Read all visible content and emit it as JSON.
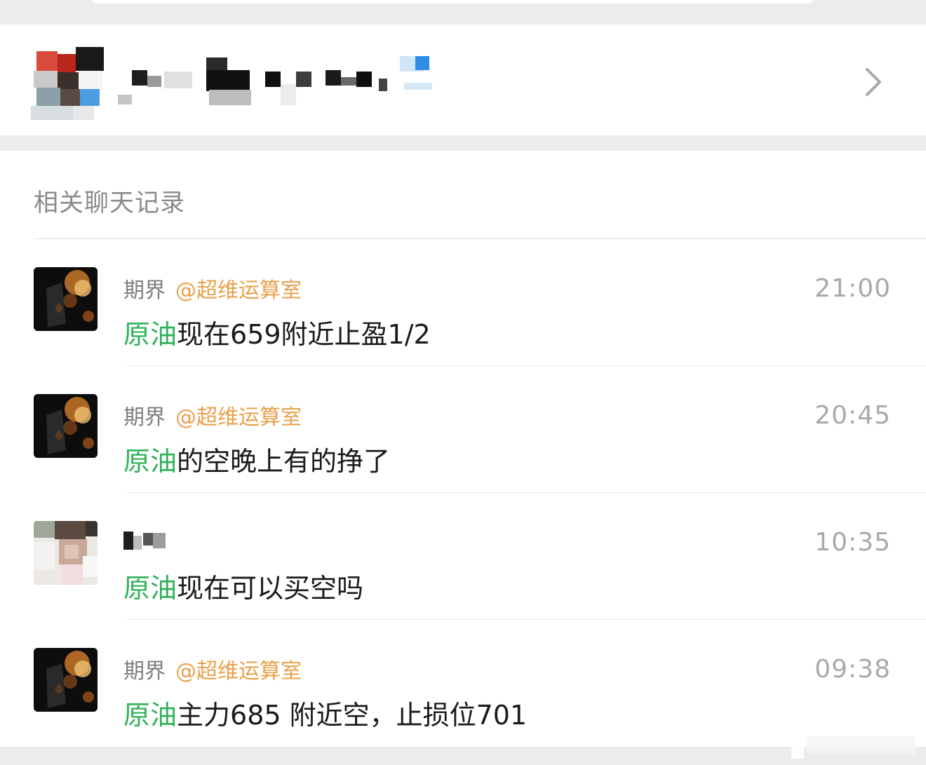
{
  "section": {
    "title": "相关聊天记录"
  },
  "results": [
    {
      "sender": "期界",
      "mention": "@超维运算室",
      "time": "21:00",
      "keyword": "原油",
      "message": "现在659附近止盈1/2",
      "avatar": "card-avatar"
    },
    {
      "sender": "期界",
      "mention": "@超维运算室",
      "time": "20:45",
      "keyword": "原油",
      "message": "的空晚上有的挣了",
      "avatar": "card-avatar"
    },
    {
      "sender": "",
      "mention": "",
      "time": "10:35",
      "keyword": "原油",
      "message": "现在可以买空吗",
      "avatar": "person-avatar"
    },
    {
      "sender": "期界",
      "mention": "@超维运算室",
      "time": "09:38",
      "keyword": "原油",
      "message": "主力685 附近空，止损位701",
      "avatar": "card-avatar"
    }
  ],
  "colors": {
    "keyword": "#2fb25a",
    "mention": "#e9a04a",
    "time": "#a9a9a9",
    "sender": "#7d7d7d"
  },
  "icons": {
    "chevron": "chevron-right-icon"
  }
}
